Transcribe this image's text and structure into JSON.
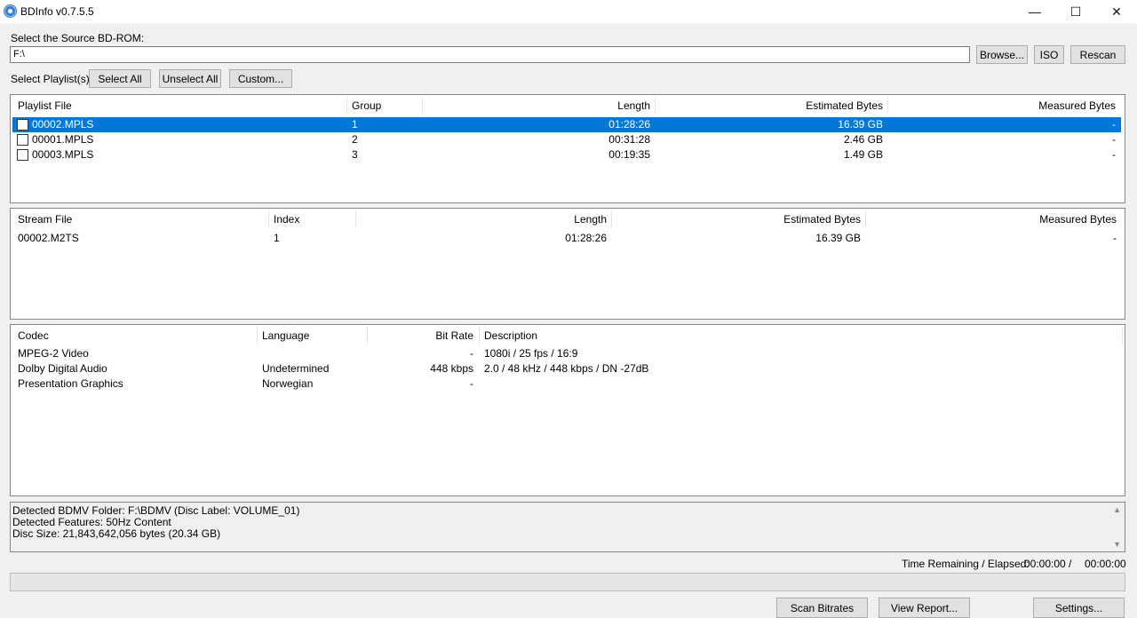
{
  "window": {
    "title": "BDInfo v0.7.5.5",
    "icon": "disc-icon",
    "controls": {
      "minimize": "—",
      "maximize": "☐",
      "close": "✕"
    }
  },
  "source": {
    "label": "Select the Source BD-ROM:",
    "path": "F:\\",
    "browse_label": "Browse...",
    "iso_label": "ISO",
    "rescan_label": "Rescan"
  },
  "playlist_select": {
    "label": "Select Playlist(s):",
    "select_all": "Select All",
    "unselect_all": "Unselect All",
    "custom": "Custom..."
  },
  "playlists": {
    "columns": [
      "Playlist File",
      "Group",
      "Length",
      "Estimated Bytes",
      "Measured Bytes"
    ],
    "rows": [
      {
        "file": "00002.MPLS",
        "group": "1",
        "length": "01:28:26",
        "estimated": "16.39 GB",
        "measured": "-",
        "selected": true,
        "checked": false
      },
      {
        "file": "00001.MPLS",
        "group": "2",
        "length": "00:31:28",
        "estimated": "2.46 GB",
        "measured": "-",
        "selected": false,
        "checked": false
      },
      {
        "file": "00003.MPLS",
        "group": "3",
        "length": "00:19:35",
        "estimated": "1.49 GB",
        "measured": "-",
        "selected": false,
        "checked": false
      }
    ]
  },
  "streams": {
    "columns": [
      "Stream File",
      "Index",
      "Length",
      "Estimated Bytes",
      "Measured Bytes"
    ],
    "rows": [
      {
        "file": "00002.M2TS",
        "index": "1",
        "length": "01:28:26",
        "estimated": "16.39 GB",
        "measured": "-"
      }
    ]
  },
  "codecs": {
    "columns": [
      "Codec",
      "Language",
      "Bit Rate",
      "Description"
    ],
    "rows": [
      {
        "codec": "MPEG-2 Video",
        "language": "",
        "bitrate": "-",
        "description": "1080i / 25 fps / 16:9"
      },
      {
        "codec": "Dolby Digital Audio",
        "language": "Undetermined",
        "bitrate": "448 kbps",
        "description": "2.0 / 48 kHz /  448 kbps / DN -27dB"
      },
      {
        "codec": "Presentation Graphics",
        "language": "Norwegian",
        "bitrate": "-",
        "description": ""
      }
    ]
  },
  "info": {
    "lines": [
      "Detected BDMV Folder: F:\\BDMV (Disc Label: VOLUME_01)",
      "Detected Features: 50Hz Content",
      "Disc Size: 21,843,642,056 bytes (20.34 GB)"
    ]
  },
  "status": {
    "label": "Time Remaining / Elapsed:",
    "remaining": "00:00:00",
    "separator": "/",
    "elapsed": "00:00:00",
    "progress": 0
  },
  "actions": {
    "scan_bitrates": "Scan Bitrates",
    "view_report": "View Report...",
    "settings": "Settings..."
  },
  "colors": {
    "selection": "#0078d7",
    "window_bg": "#f0f0f0"
  }
}
